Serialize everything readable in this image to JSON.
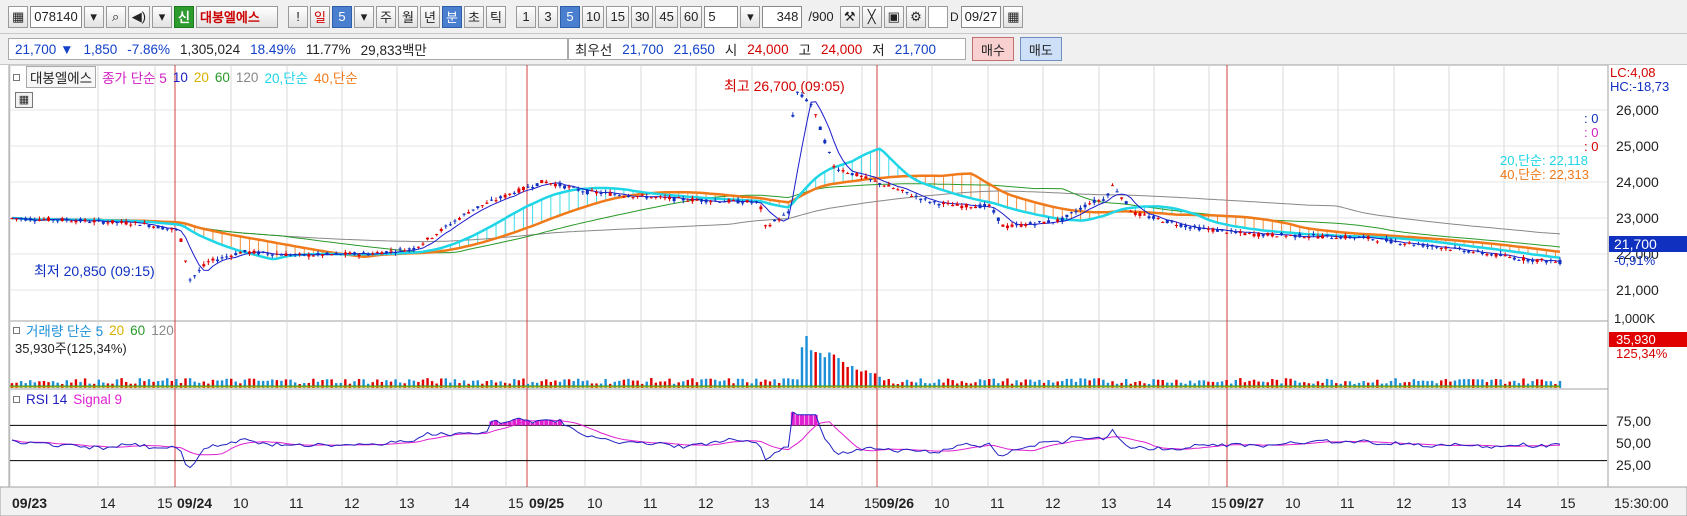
{
  "toolbar": {
    "code": "078140",
    "shin": "신",
    "stock_name": "대봉엘에스",
    "excl": "!",
    "day": "일",
    "day_val": "5",
    "periods": [
      "주",
      "월",
      "년",
      "분",
      "초",
      "틱"
    ],
    "period_active": "분",
    "minutes": [
      "1",
      "3",
      "5",
      "10",
      "15",
      "30",
      "45",
      "60"
    ],
    "minute_active": "5",
    "count_sel": "5",
    "count_val": "348",
    "count_total": "/900",
    "date": "09/27"
  },
  "info": {
    "price": "21,700",
    "arrow": "▼",
    "change": "1,850",
    "change_pct": "-7.86%",
    "volume": "1,305,024",
    "rate1": "18.49%",
    "rate2": "11.77%",
    "amount": "29,833백만",
    "best_label": "최우선",
    "best_ask": "21,700",
    "best_bid": "21,650",
    "open_label": "시",
    "open": "24,000",
    "high_label": "고",
    "high": "24,000",
    "low_label": "저",
    "low": "21,700",
    "buy": "매수",
    "sell": "매도"
  },
  "price_panel": {
    "name": "대봉엘에스",
    "legend": [
      "종가 단순 5",
      "10",
      "20",
      "60",
      "120",
      "20,단순",
      "40,단순"
    ],
    "high_note": "최고 26,700 (09:05)",
    "low_note": "최저 20,850 (09:15)",
    "lc": "LC:4,08",
    "hc": "HC:-18,73",
    "y_ticks": [
      "26,000",
      "25,000",
      "24,000",
      "23,000",
      "22,000",
      "21,000"
    ],
    "ma20": "20,단순: 22,118",
    "ma40": "40,단순: 22,313",
    "zeros": [
      ": 0",
      ": 0",
      ": 0"
    ],
    "cur_price": "21,700",
    "cur_pct": "-0,91%"
  },
  "volume_panel": {
    "legend": [
      "거래량 단순 5",
      "20",
      "60",
      "120"
    ],
    "sub": "35,930주(125,34%)",
    "tick": "1,000K",
    "cur": "35,930",
    "cur_pct": "125,34%"
  },
  "rsi_panel": {
    "legend": [
      "RSI 14",
      "Signal 9"
    ],
    "ticks": [
      "75,00",
      "50,00",
      "25,00"
    ]
  },
  "x_axis": {
    "labels": [
      "09/23",
      "14",
      "15",
      "09/24",
      "10",
      "11",
      "12",
      "13",
      "14",
      "15",
      "09/25",
      "10",
      "11",
      "12",
      "13",
      "14",
      "15",
      "09/26",
      "10",
      "11",
      "12",
      "13",
      "14",
      "15",
      "09/27",
      "10",
      "11",
      "12",
      "13",
      "14",
      "15"
    ],
    "time": "15:30:00"
  },
  "colors": {
    "up": "#e00000",
    "down": "#1030c0",
    "ma5": "#1b1bcc",
    "ma20": "#1ed6e6",
    "ma40": "#f07a1a",
    "ma60": "#2a9a2a",
    "ma120": "#888888",
    "rsi": "#2020c0",
    "signal": "#e020d0"
  }
}
